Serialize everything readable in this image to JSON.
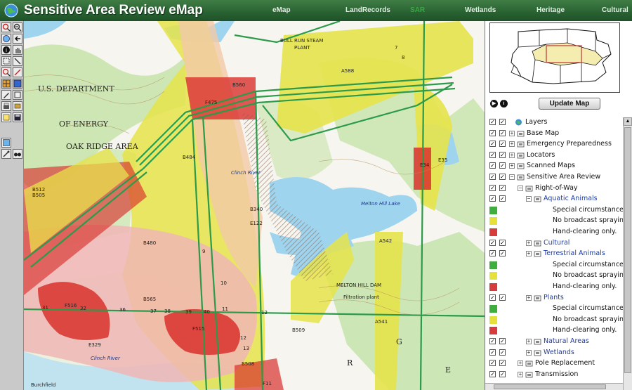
{
  "header": {
    "title": "Sensitive Area Review eMap",
    "nav": [
      {
        "label": "eMap",
        "active": false
      },
      {
        "label": "LandRecords",
        "active": false
      },
      {
        "label": "SAR",
        "active": true
      },
      {
        "label": "Wetlands",
        "active": false
      },
      {
        "label": "Heritage",
        "active": false
      },
      {
        "label": "Cultural",
        "active": false
      }
    ]
  },
  "toolbar": {
    "tools": [
      "zoom-in-icon",
      "zoom-out-icon",
      "full-extent-icon",
      "back-icon",
      "identify-icon",
      "pan-icon",
      "select-icon",
      "query-icon",
      "measure-icon",
      "buffer-icon",
      "grid-icon",
      "table-icon",
      "edit-icon",
      "clear-icon",
      "print-icon",
      "export-icon",
      "layers-icon",
      "save-icon",
      "refresh-icon",
      "find-icon",
      "binoculars-icon"
    ]
  },
  "map": {
    "labels": {
      "doe1": "U.S. DEPARTMENT",
      "doe2": "OF ENERGY",
      "doe3": "OAK RIDGE AREA",
      "steam1": "BULL RUN STEAM",
      "steam2": "PLANT",
      "clinch1": "Clinch River",
      "clinch2": "Clinch River",
      "hill": "Melton Hill Lake",
      "filtration": "Filtration plant",
      "melton": "MELTON HILL DAM",
      "b340": "B340",
      "e122": "E122",
      "b480": "B480",
      "b565": "B565",
      "f516": "F516",
      "f515": "F515",
      "e329": "E329",
      "b512": "B512",
      "b505": "B505",
      "b484": "B484",
      "f475": "F475",
      "a588": "A588",
      "b508": "B508",
      "a542": "A542",
      "a541": "A541",
      "e34": "E34",
      "e35": "E35",
      "b509": "B509",
      "b560": "B560",
      "r": "R",
      "g": "G",
      "e": "E",
      "f11": "F11",
      "burchfield": "Burchfield"
    },
    "line_numbers": [
      "31",
      "32",
      "36",
      "37",
      "38",
      "39",
      "40",
      "11",
      "12",
      "9",
      "10",
      "7",
      "8",
      "12",
      "13"
    ]
  },
  "sidepanel": {
    "update_button": "Update Map",
    "layers_root": "Layers",
    "layers": [
      {
        "label": "Base Map",
        "color": ""
      },
      {
        "label": "Emergency Preparedness",
        "color": ""
      },
      {
        "label": "Locators",
        "color": ""
      },
      {
        "label": "Scanned Maps",
        "color": ""
      },
      {
        "label": "Sensitive Area Review",
        "color": ""
      },
      {
        "label": "Right-of-Way",
        "color": ""
      },
      {
        "label": "Aquatic Animals",
        "color": ""
      },
      {
        "label": "Special circumstances",
        "color": "#3fae3f"
      },
      {
        "label": "No broadcast spraying",
        "color": "#e6e13a"
      },
      {
        "label": "Hand-clearing only.",
        "color": "#d83b3b"
      },
      {
        "label": "Cultural",
        "color": ""
      },
      {
        "label": "Terrestrial Animals",
        "color": ""
      },
      {
        "label": "Special circumstances",
        "color": "#3fae3f"
      },
      {
        "label": "No broadcast spraying",
        "color": "#e6e13a"
      },
      {
        "label": "Hand-clearing only.",
        "color": "#d83b3b"
      },
      {
        "label": "Plants",
        "color": ""
      },
      {
        "label": "Special circumstances",
        "color": "#3fae3f"
      },
      {
        "label": "No broadcast spraying",
        "color": "#e6e13a"
      },
      {
        "label": "Hand-clearing only.",
        "color": "#d83b3b"
      },
      {
        "label": "Natural Areas",
        "color": ""
      },
      {
        "label": "Wetlands",
        "color": ""
      },
      {
        "label": "Pole Replacement",
        "color": ""
      },
      {
        "label": "Transmission",
        "color": ""
      }
    ]
  }
}
